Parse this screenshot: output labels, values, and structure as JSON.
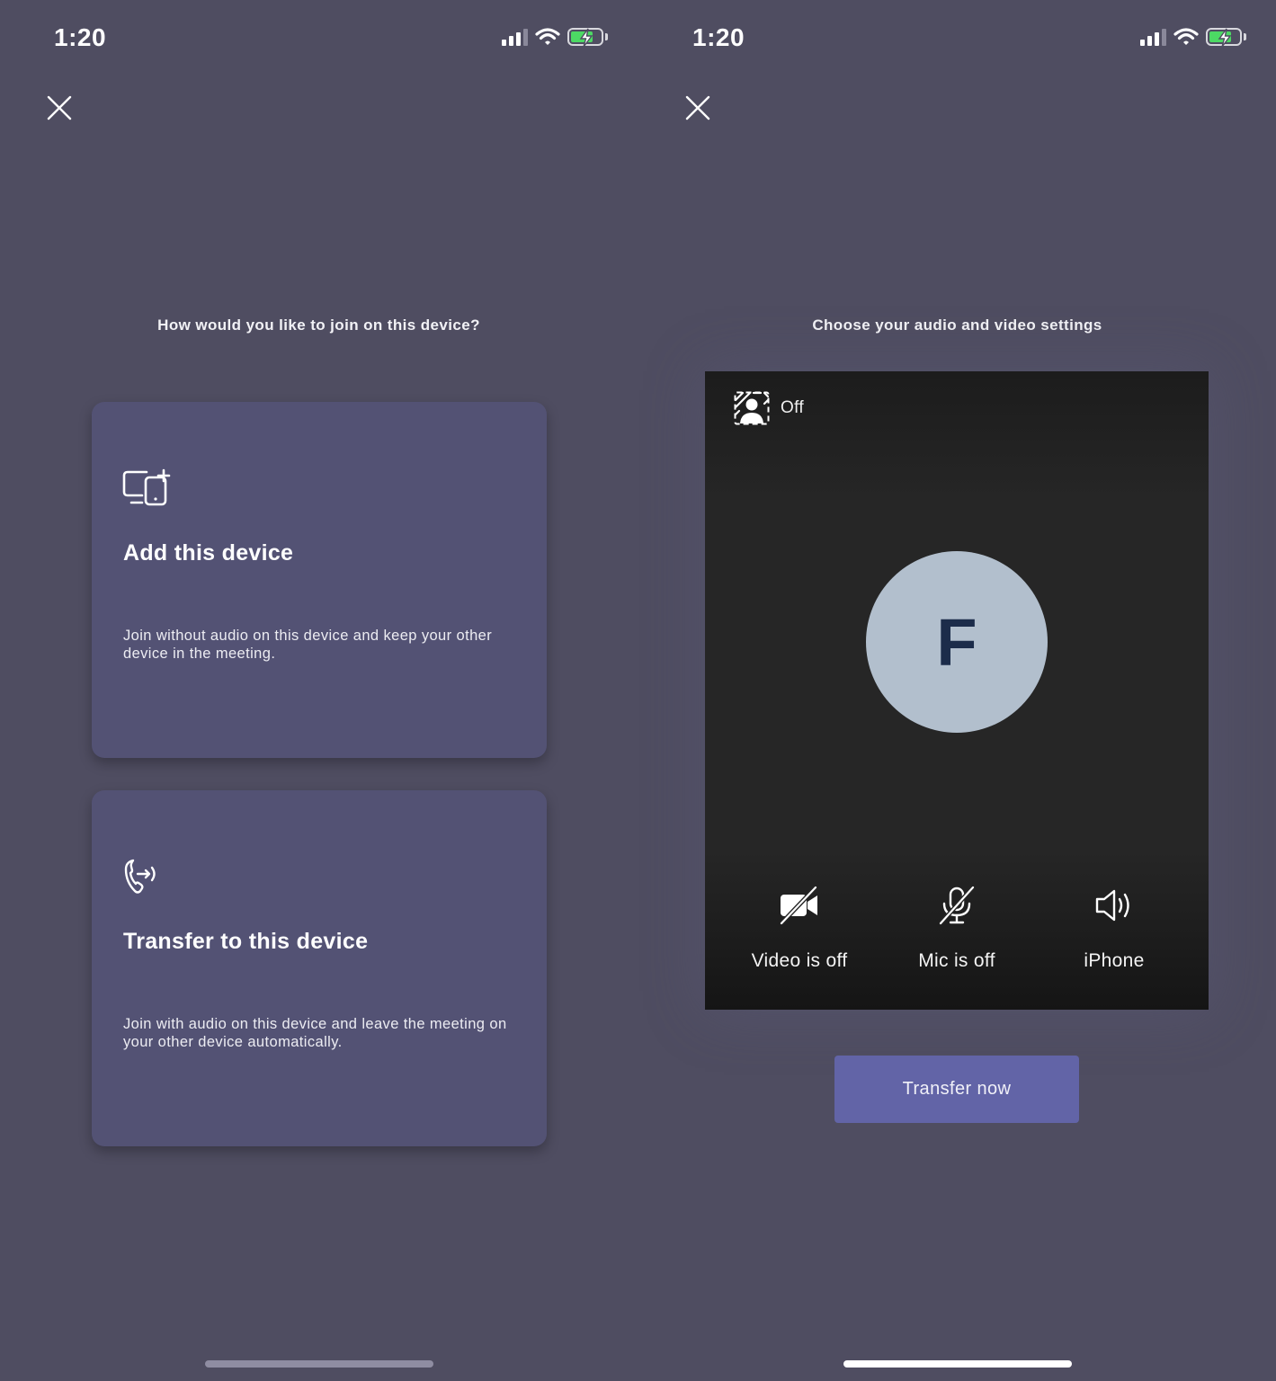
{
  "colors": {
    "background": "#4f4d61",
    "card": "#535274",
    "accent": "#6264a7",
    "preview_bg": "#262626",
    "avatar_bg": "#b2bfcd",
    "avatar_text": "#1c2c4a",
    "battery_fill": "#4cd964"
  },
  "left": {
    "status": {
      "time": "1:20",
      "icons": [
        "signal-icon",
        "wifi-icon",
        "battery-charging-icon"
      ]
    },
    "close_icon": "close-icon",
    "heading": "How would you like to join on this device?",
    "cards": [
      {
        "icon": "add-device-icon",
        "title": "Add this device",
        "description": "Join without audio on this device and keep your other device in the meeting."
      },
      {
        "icon": "phone-transfer-icon",
        "title": "Transfer to this device",
        "description": "Join with audio on this device and leave the meeting on your other device automatically."
      }
    ]
  },
  "right": {
    "status": {
      "time": "1:20",
      "icons": [
        "signal-icon",
        "wifi-icon",
        "battery-charging-icon"
      ]
    },
    "close_icon": "close-icon",
    "heading": "Choose your audio and video settings",
    "background_effects": {
      "icon": "background-effects-icon",
      "label": "Off"
    },
    "avatar_initial": "F",
    "controls": [
      {
        "icon": "video-off-icon",
        "label": "Video is off"
      },
      {
        "icon": "mic-off-icon",
        "label": "Mic is off"
      },
      {
        "icon": "speaker-icon",
        "label": "iPhone"
      }
    ],
    "transfer_button": "Transfer now"
  }
}
